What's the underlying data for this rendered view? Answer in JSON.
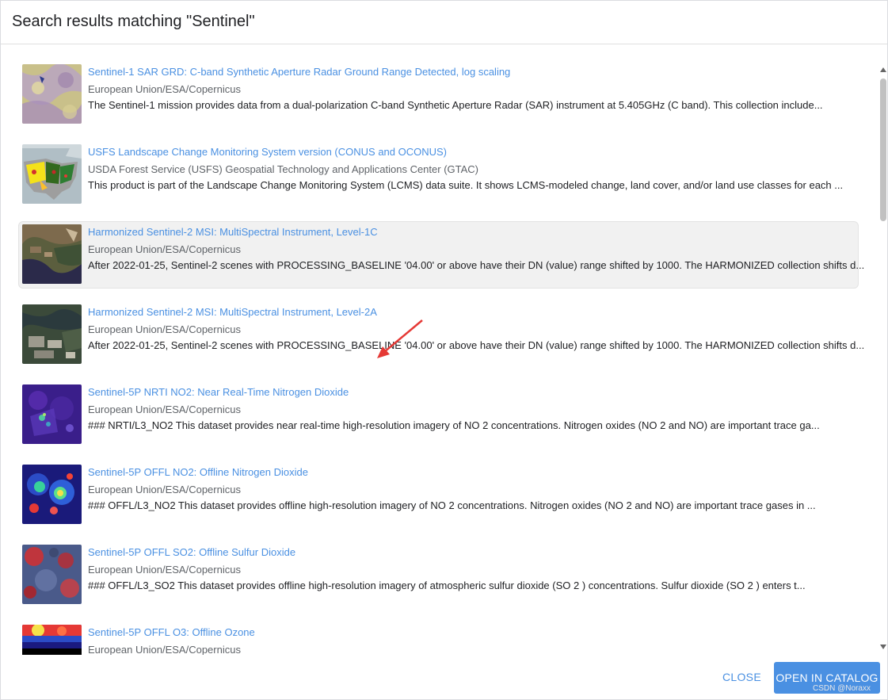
{
  "dialog": {
    "title": "Search results matching \"Sentinel\""
  },
  "results": [
    {
      "title": "Sentinel-1 SAR GRD: C-band Synthetic Aperture Radar Ground Range Detected, log scaling",
      "provider": "European Union/ESA/Copernicus",
      "description": "The Sentinel-1 mission provides data from a dual-polarization C-band Synthetic Aperture Radar (SAR) instrument at 5.405GHz (C band). This collection include...",
      "thumbnail": "sar-grd-thumbnail"
    },
    {
      "title": "USFS Landscape Change Monitoring System version (CONUS and OCONUS)",
      "provider": "USDA Forest Service (USFS) Geospatial Technology and Applications Center (GTAC)",
      "description": "This product is part of the Landscape Change Monitoring System (LCMS) data suite. It shows LCMS-modeled change, land cover, and/or land use classes for each ...",
      "thumbnail": "lcms-map-thumbnail"
    },
    {
      "title": "Harmonized Sentinel-2 MSI: MultiSpectral Instrument, Level-1C",
      "provider": "European Union/ESA/Copernicus",
      "description": "After 2022-01-25, Sentinel-2 scenes with PROCESSING_BASELINE '04.00' or above have their DN (value) range shifted by 1000. The HARMONIZED collection shifts d...",
      "thumbnail": "s2-l1c-thumbnail"
    },
    {
      "title": "Harmonized Sentinel-2 MSI: MultiSpectral Instrument, Level-2A",
      "provider": "European Union/ESA/Copernicus",
      "description": "After 2022-01-25, Sentinel-2 scenes with PROCESSING_BASELINE '04.00' or above have their DN (value) range shifted by 1000. The HARMONIZED collection shifts d...",
      "thumbnail": "s2-l2a-thumbnail"
    },
    {
      "title": "Sentinel-5P NRTI NO2: Near Real-Time Nitrogen Dioxide",
      "provider": "European Union/ESA/Copernicus",
      "description": "### NRTI/L3_NO2 This dataset provides near real-time high-resolution imagery of NO 2 concentrations. Nitrogen oxides (NO 2 and NO) are important trace ga...",
      "thumbnail": "no2-nrti-thumbnail"
    },
    {
      "title": "Sentinel-5P OFFL NO2: Offline Nitrogen Dioxide",
      "provider": "European Union/ESA/Copernicus",
      "description": "### OFFL/L3_NO2 This dataset provides offline high-resolution imagery of NO 2 concentrations. Nitrogen oxides (NO 2 and NO) are important trace gases in ...",
      "thumbnail": "no2-offl-thumbnail"
    },
    {
      "title": "Sentinel-5P OFFL SO2: Offline Sulfur Dioxide",
      "provider": "European Union/ESA/Copernicus",
      "description": "### OFFL/L3_SO2 This dataset provides offline high-resolution imagery of atmospheric sulfur dioxide (SO 2 ) concentrations. Sulfur dioxide (SO 2 ) enters t...",
      "thumbnail": "so2-offl-thumbnail"
    },
    {
      "title": "Sentinel-5P OFFL O3: Offline Ozone",
      "provider": "European Union/ESA/Copernicus",
      "description": "",
      "thumbnail": "o3-offl-thumbnail"
    }
  ],
  "footer": {
    "close_label": "CLOSE",
    "open_label": "OPEN IN CATALOG",
    "watermark": "CSDN @Noraxx"
  },
  "colors": {
    "link": "#4a90e2",
    "primary_button": "#4a90e2",
    "annotation_arrow": "#e53935",
    "hover_row": "#f1f1f1"
  }
}
